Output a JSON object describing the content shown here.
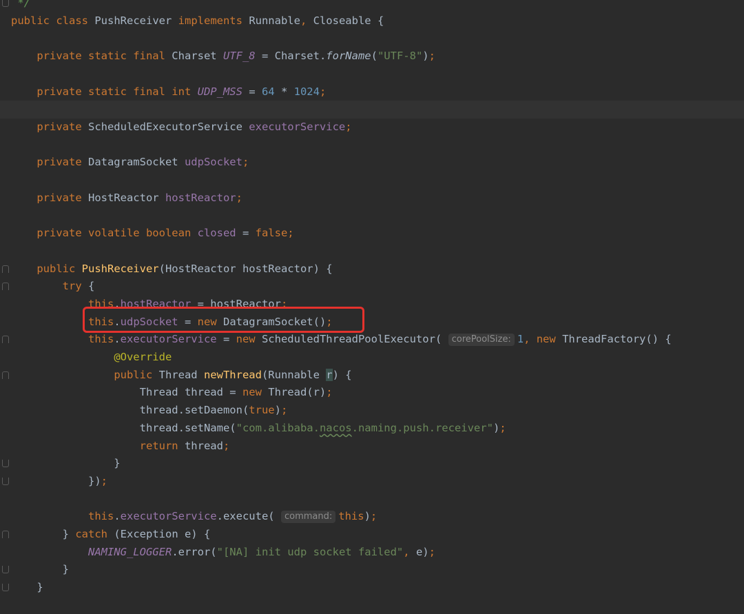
{
  "code": {
    "lines": [
      {
        "fold": "end",
        "tokens": [
          {
            "c": "cmt",
            "t": " */"
          }
        ]
      },
      {
        "tokens": [
          {
            "c": "kw",
            "t": "public class "
          },
          {
            "c": "",
            "t": "PushReceiver "
          },
          {
            "c": "kw",
            "t": "implements "
          },
          {
            "c": "",
            "t": "Runnable"
          },
          {
            "c": "kw",
            "t": ", "
          },
          {
            "c": "",
            "t": "Closeable {"
          }
        ]
      },
      {
        "tokens": []
      },
      {
        "tokens": [
          {
            "c": "",
            "t": "    "
          },
          {
            "c": "kw",
            "t": "private static final "
          },
          {
            "c": "",
            "t": "Charset "
          },
          {
            "c": "sfld",
            "t": "UTF_8"
          },
          {
            "c": "",
            "t": " = Charset."
          },
          {
            "c": "sm",
            "t": "forName"
          },
          {
            "c": "",
            "t": "("
          },
          {
            "c": "str",
            "t": "\"UTF-8\""
          },
          {
            "c": "",
            "t": ")"
          },
          {
            "c": "kw",
            "t": ";"
          }
        ]
      },
      {
        "tokens": []
      },
      {
        "tokens": [
          {
            "c": "",
            "t": "    "
          },
          {
            "c": "kw",
            "t": "private static final int "
          },
          {
            "c": "sfld",
            "t": "UDP_MSS"
          },
          {
            "c": "",
            "t": " = "
          },
          {
            "c": "num",
            "t": "64"
          },
          {
            "c": "",
            "t": " * "
          },
          {
            "c": "num",
            "t": "1024"
          },
          {
            "c": "kw",
            "t": ";"
          }
        ]
      },
      {
        "current": true,
        "tokens": []
      },
      {
        "tokens": [
          {
            "c": "",
            "t": "    "
          },
          {
            "c": "kw",
            "t": "private "
          },
          {
            "c": "",
            "t": "ScheduledExecutorService "
          },
          {
            "c": "fld",
            "t": "executorService"
          },
          {
            "c": "kw",
            "t": ";"
          }
        ]
      },
      {
        "tokens": []
      },
      {
        "tokens": [
          {
            "c": "",
            "t": "    "
          },
          {
            "c": "kw",
            "t": "private "
          },
          {
            "c": "",
            "t": "DatagramSocket "
          },
          {
            "c": "fld",
            "t": "udpSocket"
          },
          {
            "c": "kw",
            "t": ";"
          }
        ]
      },
      {
        "tokens": []
      },
      {
        "tokens": [
          {
            "c": "",
            "t": "    "
          },
          {
            "c": "kw",
            "t": "private "
          },
          {
            "c": "",
            "t": "HostReactor "
          },
          {
            "c": "fld",
            "t": "hostReactor"
          },
          {
            "c": "kw",
            "t": ";"
          }
        ]
      },
      {
        "tokens": []
      },
      {
        "tokens": [
          {
            "c": "",
            "t": "    "
          },
          {
            "c": "kw",
            "t": "private volatile boolean "
          },
          {
            "c": "fld",
            "t": "closed"
          },
          {
            "c": "",
            "t": " = "
          },
          {
            "c": "kw",
            "t": "false;"
          }
        ]
      },
      {
        "tokens": []
      },
      {
        "fold": "start",
        "tokens": [
          {
            "c": "",
            "t": "    "
          },
          {
            "c": "kw",
            "t": "public "
          },
          {
            "c": "fn",
            "t": "PushReceiver"
          },
          {
            "c": "",
            "t": "(HostReactor hostReactor) {"
          }
        ]
      },
      {
        "fold": "start",
        "tokens": [
          {
            "c": "",
            "t": "        "
          },
          {
            "c": "kw",
            "t": "try "
          },
          {
            "c": "",
            "t": "{"
          }
        ]
      },
      {
        "tokens": [
          {
            "c": "",
            "t": "            "
          },
          {
            "c": "kw",
            "t": "this"
          },
          {
            "c": "",
            "t": "."
          },
          {
            "c": "fld",
            "t": "hostReactor"
          },
          {
            "c": "",
            "t": " = hostReactor"
          },
          {
            "c": "kw",
            "t": ";"
          }
        ]
      },
      {
        "tokens": [
          {
            "c": "",
            "t": "            "
          },
          {
            "c": "kw",
            "t": "this"
          },
          {
            "c": "",
            "t": "."
          },
          {
            "c": "fld",
            "t": "udpSocket"
          },
          {
            "c": "",
            "t": " = "
          },
          {
            "c": "kw",
            "t": "new "
          },
          {
            "c": "",
            "t": "DatagramSocket()"
          },
          {
            "c": "kw",
            "t": ";"
          }
        ]
      },
      {
        "fold": "start",
        "tokens": [
          {
            "c": "",
            "t": "            "
          },
          {
            "c": "kw",
            "t": "this"
          },
          {
            "c": "",
            "t": "."
          },
          {
            "c": "fld",
            "t": "executorService"
          },
          {
            "c": "",
            "t": " = "
          },
          {
            "c": "kw",
            "t": "new "
          },
          {
            "c": "",
            "t": "ScheduledThreadPoolExecutor( "
          },
          {
            "c": "hint",
            "t": "corePoolSize:"
          },
          {
            "c": "num",
            "t": "1"
          },
          {
            "c": "kw",
            "t": ", new "
          },
          {
            "c": "",
            "t": "ThreadFactory() {"
          }
        ]
      },
      {
        "tokens": [
          {
            "c": "",
            "t": "                "
          },
          {
            "c": "ann",
            "t": "@Override"
          }
        ]
      },
      {
        "fold": "start",
        "tokens": [
          {
            "c": "",
            "t": "                "
          },
          {
            "c": "kw",
            "t": "public "
          },
          {
            "c": "",
            "t": "Thread "
          },
          {
            "c": "fn",
            "t": "newThread"
          },
          {
            "c": "",
            "t": "(Runnable "
          },
          {
            "c": "caret",
            "t": "r"
          },
          {
            "c": "",
            "t": ") {"
          }
        ]
      },
      {
        "tokens": [
          {
            "c": "",
            "t": "                    Thread thread = "
          },
          {
            "c": "kw",
            "t": "new "
          },
          {
            "c": "",
            "t": "Thread(r)"
          },
          {
            "c": "kw",
            "t": ";"
          }
        ]
      },
      {
        "tokens": [
          {
            "c": "",
            "t": "                    thread.setDaemon("
          },
          {
            "c": "kw",
            "t": "true"
          },
          {
            "c": "",
            "t": ")"
          },
          {
            "c": "kw",
            "t": ";"
          }
        ]
      },
      {
        "tokens": [
          {
            "c": "",
            "t": "                    thread.setName("
          },
          {
            "c": "str",
            "t": "\"com.alibaba."
          },
          {
            "c": "str squig",
            "t": "nacos"
          },
          {
            "c": "str",
            "t": ".naming.push.receiver\""
          },
          {
            "c": "",
            "t": ")"
          },
          {
            "c": "kw",
            "t": ";"
          }
        ]
      },
      {
        "tokens": [
          {
            "c": "",
            "t": "                    "
          },
          {
            "c": "kw",
            "t": "return "
          },
          {
            "c": "",
            "t": "thread"
          },
          {
            "c": "kw",
            "t": ";"
          }
        ]
      },
      {
        "fold": "end",
        "tokens": [
          {
            "c": "",
            "t": "                }"
          }
        ]
      },
      {
        "fold": "end",
        "tokens": [
          {
            "c": "",
            "t": "            })"
          },
          {
            "c": "kw",
            "t": ";"
          }
        ]
      },
      {
        "tokens": []
      },
      {
        "tokens": [
          {
            "c": "",
            "t": "            "
          },
          {
            "c": "kw",
            "t": "this"
          },
          {
            "c": "",
            "t": "."
          },
          {
            "c": "fld",
            "t": "executorService"
          },
          {
            "c": "",
            "t": ".execute( "
          },
          {
            "c": "hint",
            "t": "command:"
          },
          {
            "c": "kw",
            "t": "this"
          },
          {
            "c": "",
            "t": ")"
          },
          {
            "c": "kw",
            "t": ";"
          }
        ]
      },
      {
        "fold": "start",
        "tokens": [
          {
            "c": "",
            "t": "        } "
          },
          {
            "c": "kw",
            "t": "catch "
          },
          {
            "c": "",
            "t": "(Exception e) {"
          }
        ]
      },
      {
        "tokens": [
          {
            "c": "",
            "t": "            "
          },
          {
            "c": "sfld",
            "t": "NAMING_LOGGER"
          },
          {
            "c": "",
            "t": ".error("
          },
          {
            "c": "str",
            "t": "\"[NA] init udp socket failed\""
          },
          {
            "c": "kw",
            "t": ", "
          },
          {
            "c": "",
            "t": "e)"
          },
          {
            "c": "kw",
            "t": ";"
          }
        ]
      },
      {
        "fold": "end",
        "tokens": [
          {
            "c": "",
            "t": "        }"
          }
        ]
      },
      {
        "fold": "end",
        "tokens": [
          {
            "c": "",
            "t": "    }"
          }
        ]
      },
      {
        "tokens": []
      }
    ]
  },
  "highlight": {
    "label": "udpSocket initialization highlight",
    "color": "#e5322d"
  }
}
